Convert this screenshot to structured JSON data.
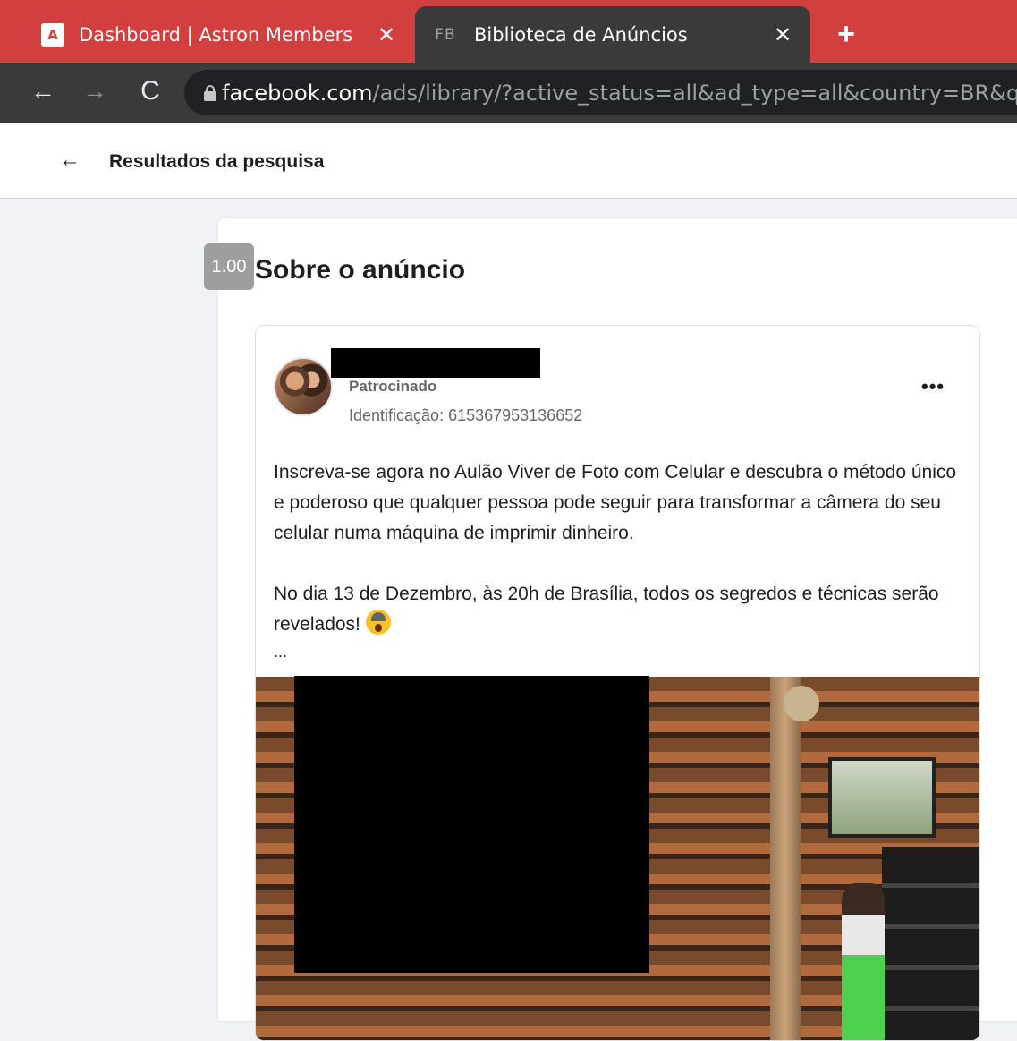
{
  "browser": {
    "tabs": [
      {
        "title": "Dashboard | Astron Members",
        "favicon": "astron-logo-icon",
        "close": "✕",
        "active": false
      },
      {
        "title": "Biblioteca de Anúncios",
        "favicon_text": "FB",
        "close": "✕",
        "active": true
      }
    ],
    "new_tab": "+",
    "nav": {
      "back": "←",
      "forward": "→",
      "reload": "C"
    },
    "url": {
      "host": "facebook.com",
      "path": "/ads/library/?active_status=all&ad_type=all&country=BR&q=c"
    },
    "colors": {
      "tabbar": "#d23f3f",
      "toolbar": "#3a3a3a",
      "omnibox": "#202124"
    }
  },
  "header": {
    "back_arrow": "←",
    "title": "Resultados da pesquisa"
  },
  "panel": {
    "zoom_badge": "1.00",
    "title": "Sobre o anúncio"
  },
  "ad": {
    "sponsored_label": "Patrocinado",
    "id_text": "Identificação: 615367953136652",
    "more_icon": "•••",
    "body": [
      "Inscreva-se agora no Aulão Viver de Foto com Celular e descubra o método único e poderoso que qualquer pessoa pode seguir para transformar a câmera do seu celular numa máquina de imprimir dinheiro.",
      "No dia 13 de Dezembro, às 20h de Brasília, todos os segredos e técnicas serão revelados!"
    ],
    "emoji": "face-screaming-emoji",
    "ellipsis": "..."
  }
}
